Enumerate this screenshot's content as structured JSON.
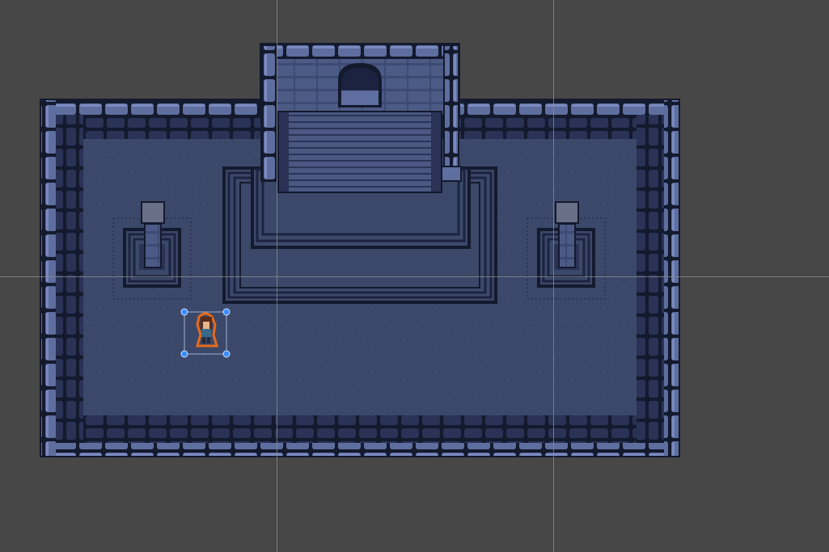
{
  "scene_view": {
    "background_color": "#474747",
    "grid_color": "#8a8a8a"
  },
  "map": {
    "palette": {
      "outline": "#141a2e",
      "wall_light": "#5e6e9e",
      "wall_light_hi": "#7a8ac0",
      "wall_dark": "#2a3356",
      "wall_darker": "#1c2340",
      "floor": "#3b4869",
      "floor_dot": "#4d5b82",
      "stair": "#4a5882",
      "stair_edge": "#2a3356"
    }
  },
  "selection": {
    "handle_color": "#3c8cff",
    "outline_color": "#e86a1a",
    "character_hair": "#5a2a1a",
    "character_skin": "#e8b48c",
    "character_clothes": "#3a6a8a"
  }
}
